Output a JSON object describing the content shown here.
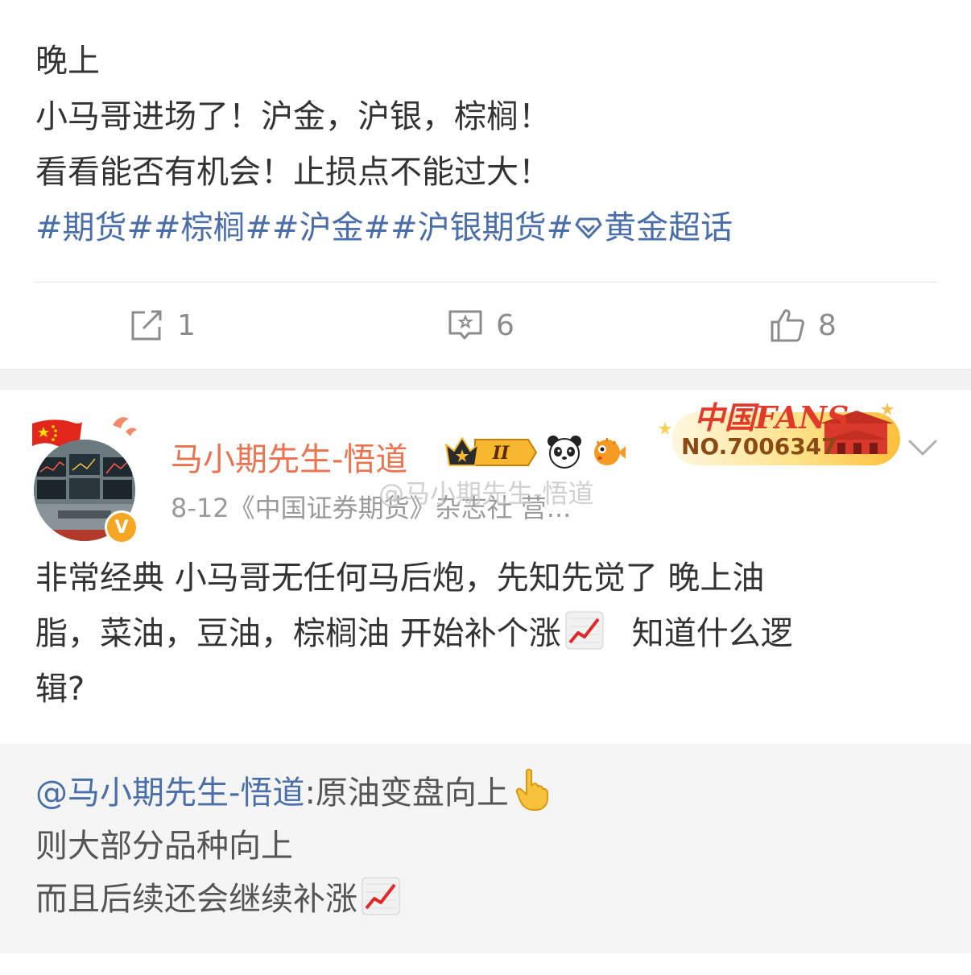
{
  "post1": {
    "lines": [
      "晚上",
      "小马哥进场了！沪金，沪银，棕榈！",
      "看看能否有机会！止损点不能过大！"
    ],
    "tags": "#期货##棕榈##沪金##沪银期货#",
    "super_topic": "黄金超话",
    "actions": {
      "repost_count": "1",
      "comment_count": "6",
      "like_count": "8"
    }
  },
  "post2": {
    "username": "马小期先生-悟道",
    "level_badge": "II",
    "meta": "8-12《中国证券期货》杂志社 营...",
    "watermark": "@马小期先生-悟道",
    "fans_badge": {
      "title": "中国FANS",
      "number": "NO.7006347"
    },
    "verified_mark": "V",
    "body_lines": [
      "非常经典 小马哥无任何马后炮，先知先觉了 晚上油",
      "脂，菜油，豆油，棕榈油 开始补个涨",
      "知道什么逻",
      "辑?"
    ],
    "repost": {
      "mention": "@马小期先生-悟道",
      "first_text": ":原油变盘向上",
      "line2": "则大部分品种向上",
      "line3": "而且后续还会继续补涨"
    }
  },
  "colors": {
    "link": "#4a6ea9",
    "username": "#eb7350",
    "muted": "#9a9a9a",
    "text": "#333333"
  },
  "icons": [
    "repost-icon",
    "comment-icon",
    "like-icon",
    "chart-increasing-icon",
    "pointing-up-icon",
    "diamond-icon",
    "crown-icon",
    "panda-icon",
    "pufferfish-icon",
    "chevron-down-icon"
  ]
}
